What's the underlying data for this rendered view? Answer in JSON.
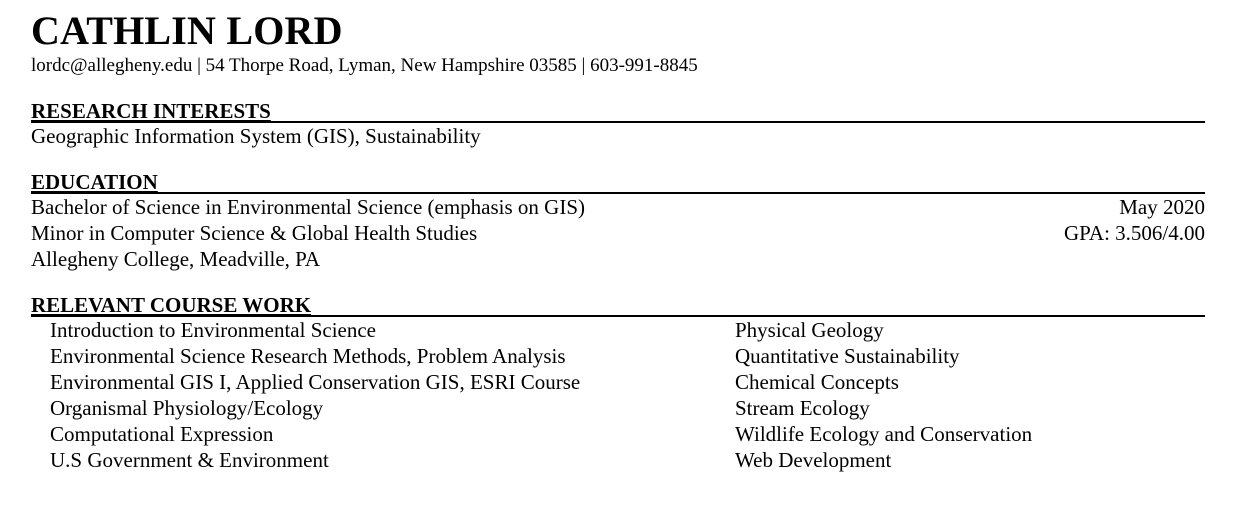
{
  "header": {
    "name": "CATHLIN LORD",
    "contact": "lordc@allegheny.edu | 54 Thorpe Road, Lyman, New Hampshire 03585 | 603-991-8845"
  },
  "research": {
    "heading": "RESEARCH INTERESTS",
    "text": "Geographic Information System (GIS), Sustainability"
  },
  "education": {
    "heading": "EDUCATION",
    "rows": [
      {
        "left": "Bachelor of Science in Environmental Science (emphasis on GIS)",
        "right": "May 2020"
      },
      {
        "left": "Minor in Computer Science & Global Health Studies",
        "right": "GPA: 3.506/4.00"
      },
      {
        "left": "Allegheny College, Meadville, PA",
        "right": ""
      }
    ]
  },
  "coursework": {
    "heading": "RELEVANT COURSE WORK",
    "left": [
      "Introduction to Environmental Science",
      "Environmental Science Research Methods, Problem Analysis",
      "Environmental GIS I, Applied Conservation GIS, ESRI Course",
      "Organismal Physiology/Ecology",
      "Computational Expression",
      "U.S Government & Environment"
    ],
    "right": [
      "Physical Geology",
      "Quantitative Sustainability",
      "Chemical Concepts",
      "Stream Ecology",
      "Wildlife Ecology and Conservation",
      "Web Development"
    ]
  }
}
